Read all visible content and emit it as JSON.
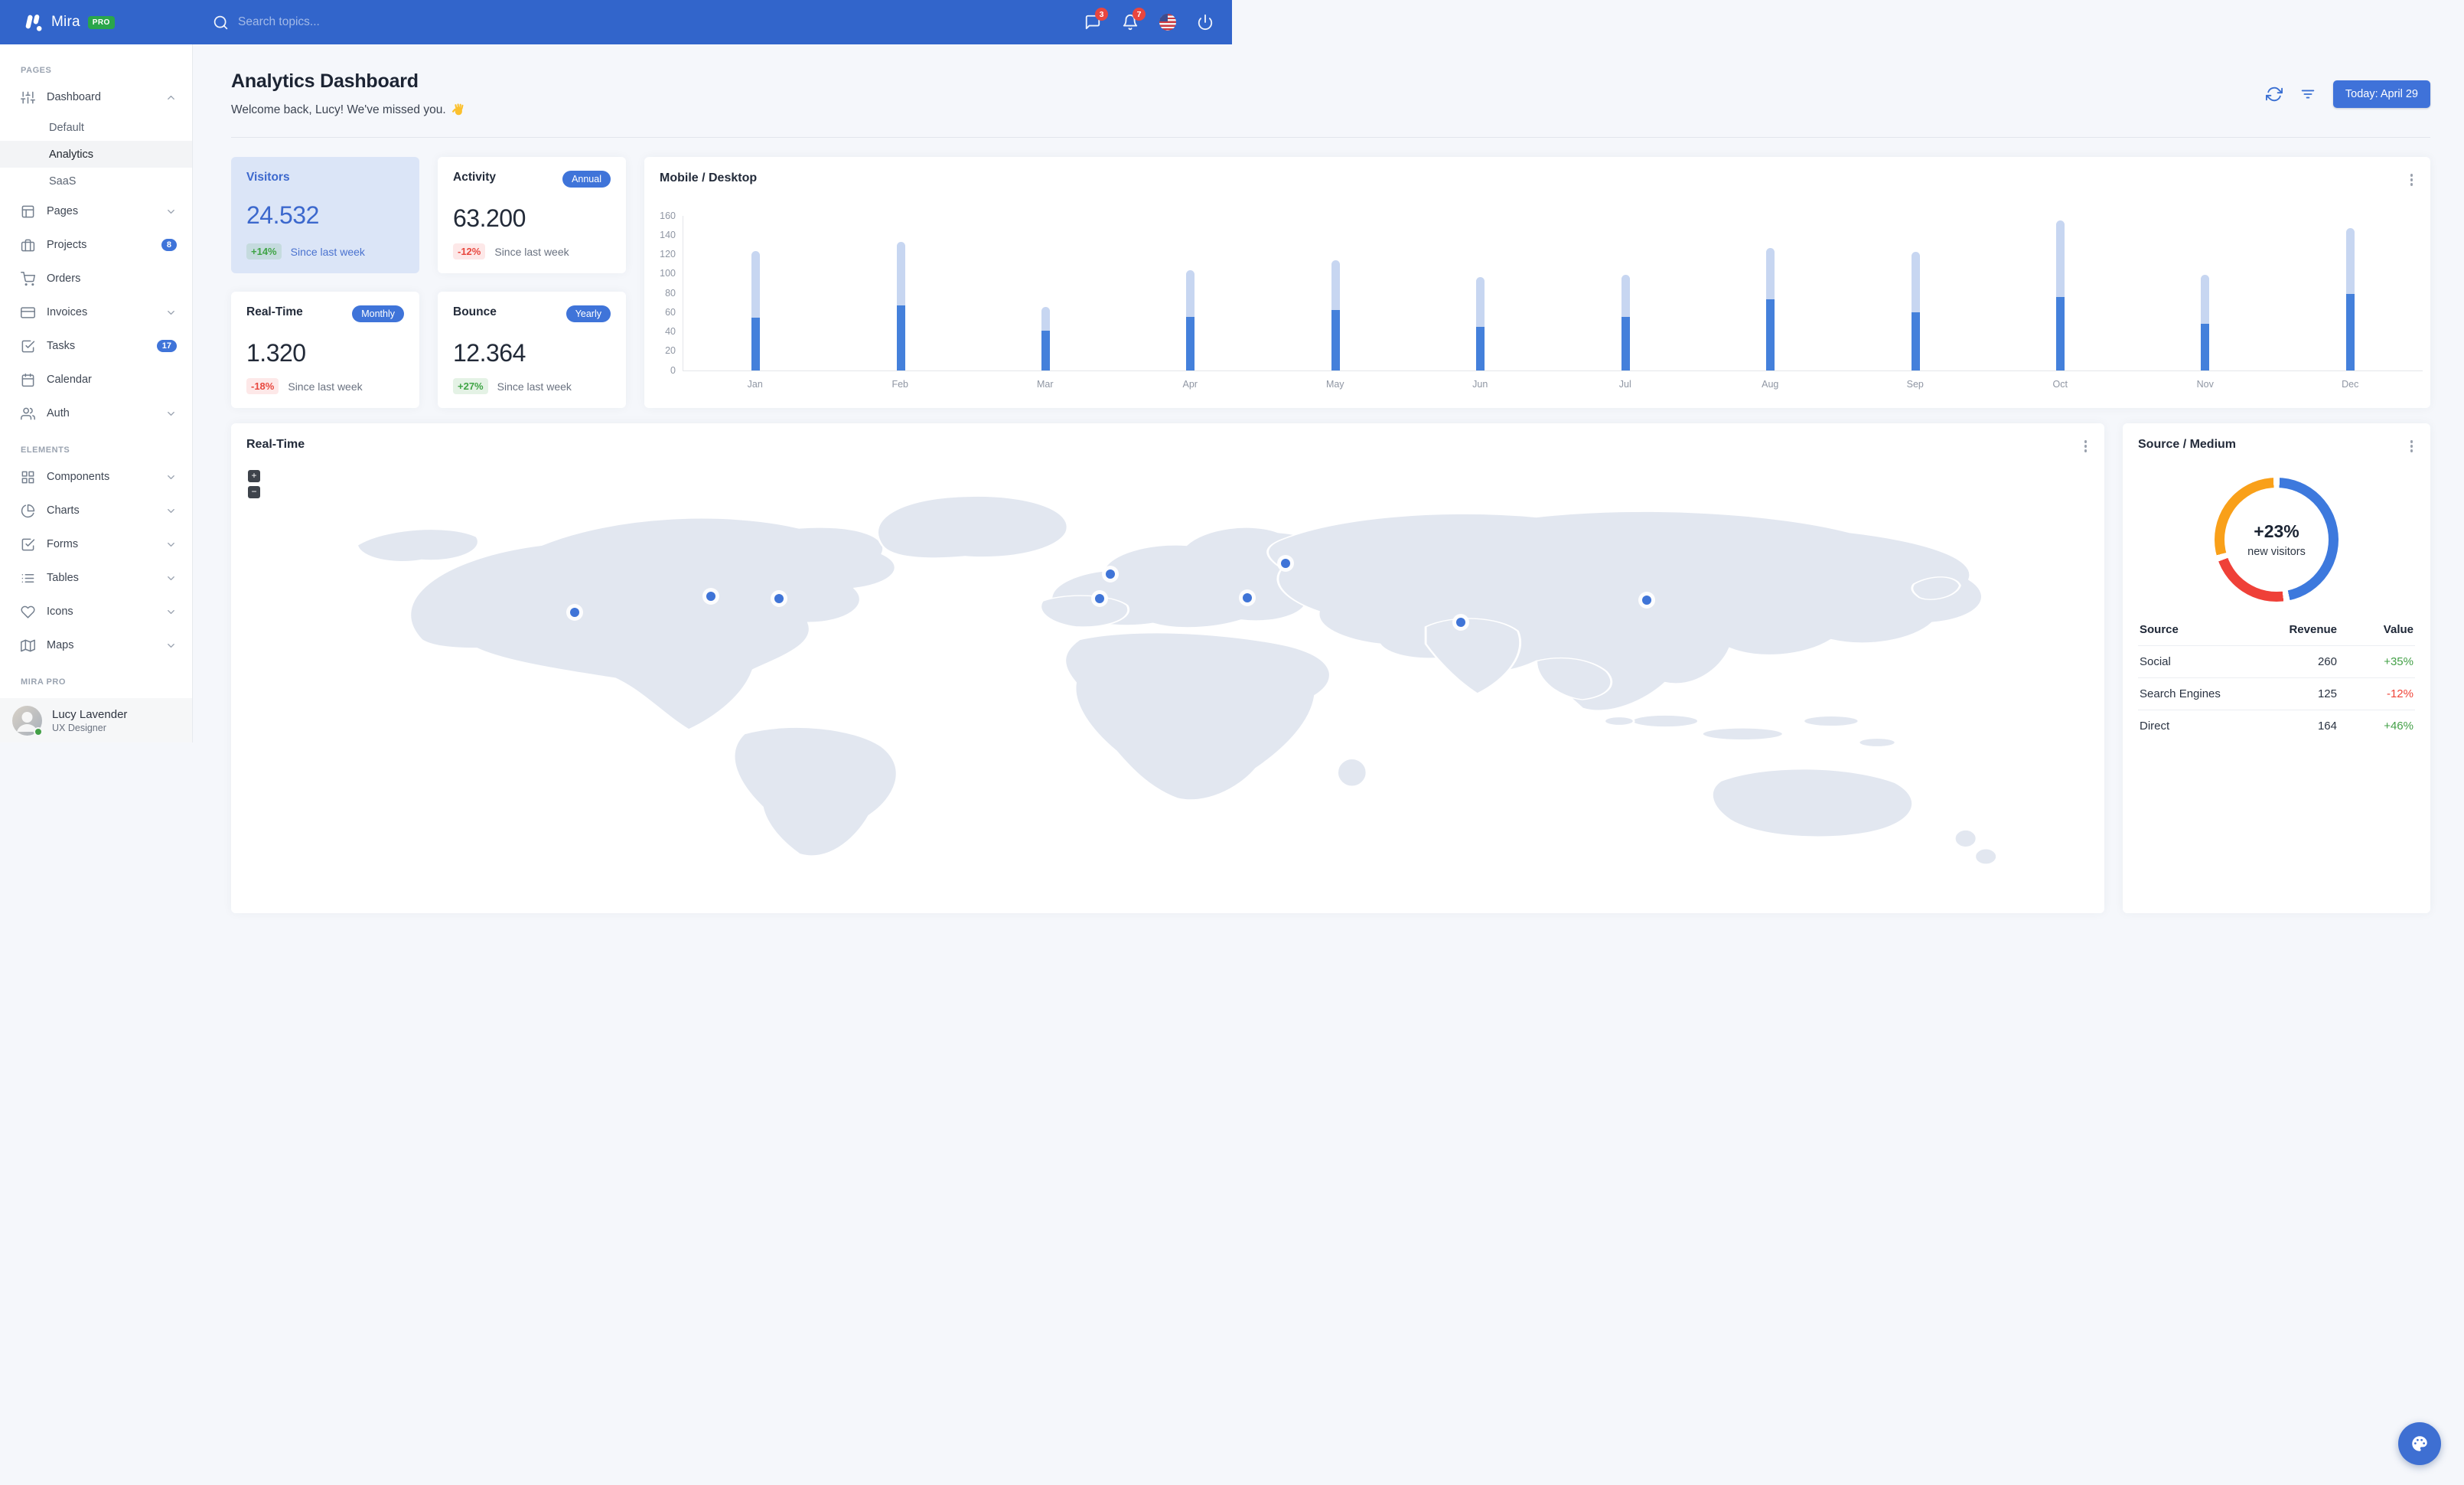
{
  "colors": {
    "navbar": "#3265cb",
    "primary": "#3f72d9",
    "positive": "#43a047",
    "negative": "#e8483f",
    "bar_mobile": "#4480db",
    "bar_desktop": "#c7d6f1",
    "donut_blue": "#3d79dd",
    "donut_red": "#ef4038",
    "donut_orange": "#f9a019"
  },
  "navbar": {
    "brand": "Mira",
    "brand_badge": "PRO",
    "search_placeholder": "Search topics...",
    "messages_badge": "3",
    "alerts_badge": "7"
  },
  "sidebar": {
    "sections": [
      {
        "label": "PAGES",
        "items": [
          {
            "label": "Dashboard",
            "icon": "sliders-icon",
            "chevron": "up",
            "children": [
              {
                "label": "Default",
                "active": false
              },
              {
                "label": "Analytics",
                "active": true
              },
              {
                "label": "SaaS",
                "active": false
              }
            ]
          },
          {
            "label": "Pages",
            "icon": "layout-icon",
            "chevron": "down"
          },
          {
            "label": "Projects",
            "icon": "briefcase-icon",
            "badge": "8"
          },
          {
            "label": "Orders",
            "icon": "cart-icon"
          },
          {
            "label": "Invoices",
            "icon": "credit-card-icon",
            "chevron": "down"
          },
          {
            "label": "Tasks",
            "icon": "check-square-icon",
            "badge": "17"
          },
          {
            "label": "Calendar",
            "icon": "calendar-icon"
          },
          {
            "label": "Auth",
            "icon": "users-icon",
            "chevron": "down"
          }
        ]
      },
      {
        "label": "ELEMENTS",
        "items": [
          {
            "label": "Components",
            "icon": "grid-icon",
            "chevron": "down"
          },
          {
            "label": "Charts",
            "icon": "pie-chart-icon",
            "chevron": "down"
          },
          {
            "label": "Forms",
            "icon": "check-square-icon",
            "chevron": "down"
          },
          {
            "label": "Tables",
            "icon": "list-icon",
            "chevron": "down"
          },
          {
            "label": "Icons",
            "icon": "heart-icon",
            "chevron": "down"
          },
          {
            "label": "Maps",
            "icon": "map-icon",
            "chevron": "down"
          }
        ]
      },
      {
        "label": "MIRA PRO",
        "items": []
      }
    ],
    "user": {
      "name": "Lucy Lavender",
      "role": "UX Designer"
    }
  },
  "header": {
    "title": "Analytics Dashboard",
    "subtitle": "Welcome back, Lucy! We've missed you.",
    "wave_emoji": "👋",
    "date_button": "Today: April 29"
  },
  "stats": [
    {
      "title": "Visitors",
      "value": "24.532",
      "delta": "+14%",
      "delta_kind": "positive",
      "note": "Since last week",
      "variant": "primary"
    },
    {
      "title": "Activity",
      "value": "63.200",
      "delta": "-12%",
      "delta_kind": "negative",
      "note": "Since last week",
      "badge": "Annual"
    },
    {
      "title": "Real-Time",
      "value": "1.320",
      "delta": "-18%",
      "delta_kind": "negative",
      "note": "Since last week",
      "badge": "Monthly"
    },
    {
      "title": "Bounce",
      "value": "12.364",
      "delta": "+27%",
      "delta_kind": "positive",
      "note": "Since last week",
      "badge": "Yearly"
    }
  ],
  "chart_data": [
    {
      "type": "bar",
      "title": "Mobile / Desktop",
      "stacked": true,
      "categories": [
        "Jan",
        "Feb",
        "Mar",
        "Apr",
        "May",
        "Jun",
        "Jul",
        "Aug",
        "Sep",
        "Oct",
        "Nov",
        "Dec"
      ],
      "series": [
        {
          "name": "Mobile",
          "color": "#4480db",
          "values": [
            54,
            67,
            41,
            55,
            62,
            45,
            55,
            73,
            60,
            76,
            48,
            79
          ]
        },
        {
          "name": "Desktop",
          "color": "#c7d6f1",
          "values": [
            69,
            66,
            24,
            48,
            52,
            51,
            44,
            53,
            62,
            79,
            51,
            68
          ]
        }
      ],
      "xlabel": "",
      "ylabel": "",
      "ylim": [
        0,
        160
      ],
      "ytick_step": 20,
      "grid": false,
      "legend": "none"
    },
    {
      "type": "donut",
      "title": "Source / Medium",
      "center_value": "+23%",
      "center_label": "new visitors",
      "start": "top",
      "direction": "clockwise",
      "gap_degrees": 6,
      "ring_thickness_px": 13,
      "segments": [
        {
          "label": "Social",
          "value": 260,
          "color": "#3d79dd"
        },
        {
          "label": "Search Engines",
          "value": 125,
          "color": "#ef4038"
        },
        {
          "label": "Direct",
          "value": 164,
          "color": "#f9a019"
        }
      ]
    }
  ],
  "map_card": {
    "title": "Real-Time",
    "zoom_in_label": "+",
    "zoom_out_label": "−",
    "markers": [
      {
        "name": "west-coast-us",
        "x": 17.8,
        "y": 34.8
      },
      {
        "name": "chicago",
        "x": 25.2,
        "y": 31.0
      },
      {
        "name": "new-york",
        "x": 28.9,
        "y": 31.5
      },
      {
        "name": "london",
        "x": 46.9,
        "y": 25.8
      },
      {
        "name": "spain",
        "x": 46.3,
        "y": 31.5
      },
      {
        "name": "moscow",
        "x": 56.4,
        "y": 23.3
      },
      {
        "name": "turkey",
        "x": 54.3,
        "y": 31.3
      },
      {
        "name": "india",
        "x": 65.9,
        "y": 37.1
      },
      {
        "name": "china",
        "x": 76.0,
        "y": 31.9
      }
    ]
  },
  "source_card": {
    "title": "Source / Medium",
    "table": {
      "headers": [
        "Source",
        "Revenue",
        "Value"
      ],
      "rows": [
        {
          "source": "Social",
          "revenue": "260",
          "value": "+35%",
          "kind": "positive"
        },
        {
          "source": "Search Engines",
          "revenue": "125",
          "value": "-12%",
          "kind": "negative"
        },
        {
          "source": "Direct",
          "revenue": "164",
          "value": "+46%",
          "kind": "positive"
        }
      ]
    }
  }
}
